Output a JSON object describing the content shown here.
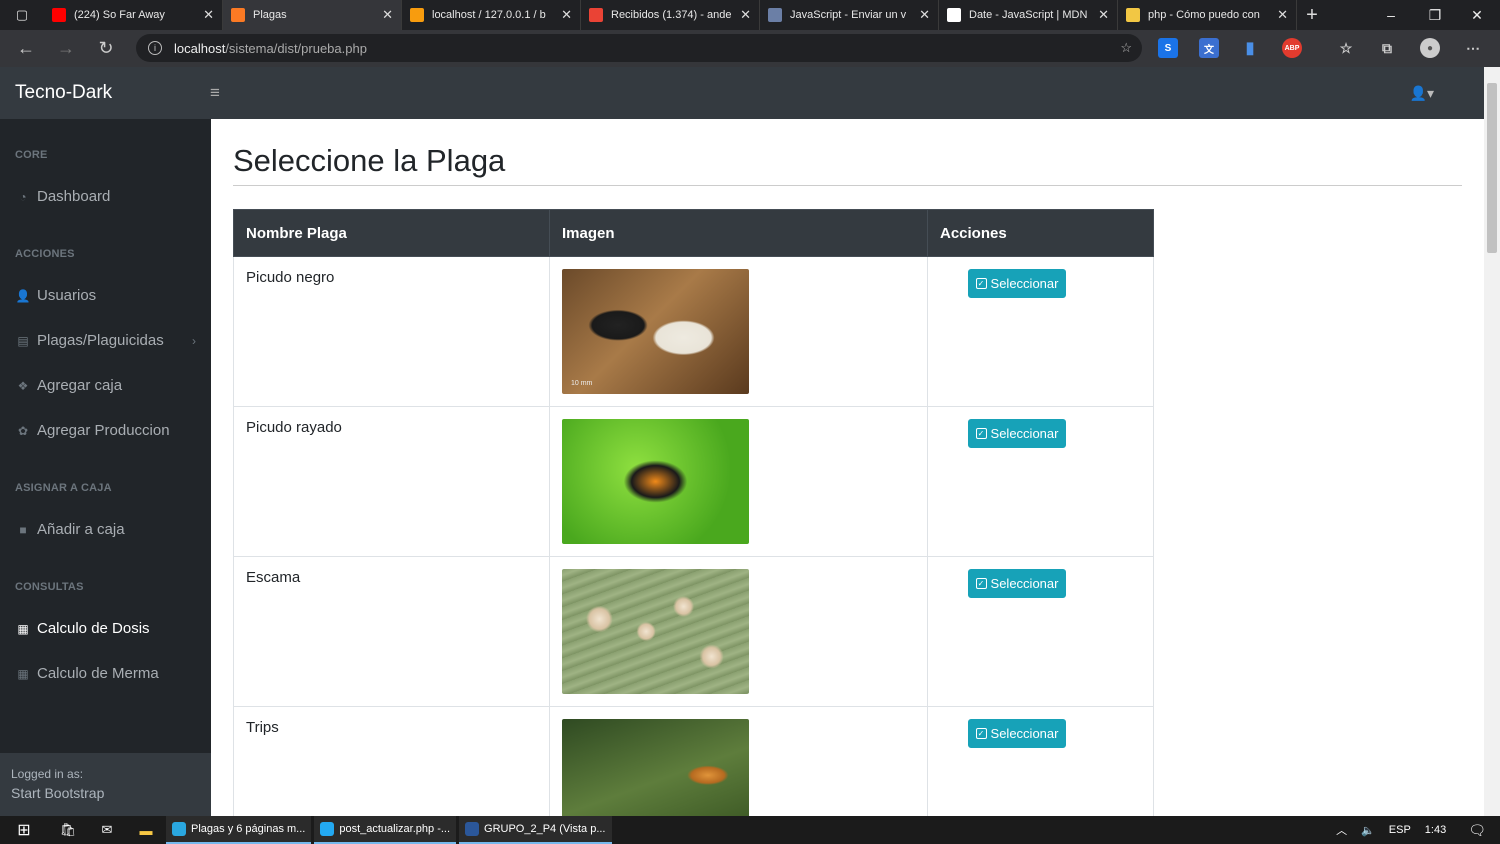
{
  "browser": {
    "tabs": [
      {
        "title": "(224) So Far Away",
        "icon": "youtube-icon",
        "color": "#ff0000",
        "active": false
      },
      {
        "title": "Plagas",
        "icon": "xampp-icon",
        "color": "#fb7a24",
        "active": true
      },
      {
        "title": "localhost / 127.0.0.1 / b",
        "icon": "phpmyadmin-icon",
        "color": "#f89c0e",
        "active": false
      },
      {
        "title": "Recibidos (1.374) - ande",
        "icon": "gmail-icon",
        "color": "#ea4335",
        "active": false
      },
      {
        "title": "JavaScript - Enviar un v",
        "icon": "page-icon",
        "color": "#6b7fa6",
        "active": false
      },
      {
        "title": "Date - JavaScript | MDN",
        "icon": "mdn-icon",
        "color": "#ffffff",
        "active": false
      },
      {
        "title": "php - Cómo puedo con",
        "icon": "stackoverflow-icon",
        "color": "#f2c744",
        "active": false
      }
    ],
    "url_host": "localhost",
    "url_path": "/sistema/dist/prueba.php"
  },
  "navbar": {
    "brand": "Tecno-Dark"
  },
  "sidebar": {
    "headings": [
      "CORE",
      "ACCIONES",
      "ASIGNAR A CAJA",
      "CONSULTAS"
    ],
    "items": [
      {
        "label": "Dashboard",
        "icon": "dashboard-icon"
      },
      {
        "label": "Usuarios",
        "icon": "user-add-icon"
      },
      {
        "label": "Plagas/Plaguicidas",
        "icon": "list-icon"
      },
      {
        "label": "Agregar caja",
        "icon": "boxes-icon"
      },
      {
        "label": "Agregar Produccion",
        "icon": "seedling-icon"
      },
      {
        "label": "Añadir a caja",
        "icon": "box-icon"
      },
      {
        "label": "Calculo de Dosis",
        "icon": "calculator-icon"
      },
      {
        "label": "Calculo de Merma",
        "icon": "calculator-icon"
      }
    ],
    "footer_label": "Logged in as:",
    "footer_user": "Start Bootstrap"
  },
  "page": {
    "title": "Seleccione la Plaga",
    "table": {
      "headers": [
        "Nombre Plaga",
        "Imagen",
        "Acciones"
      ],
      "rows": [
        {
          "name": "Picudo negro",
          "image_caption": "10 mm",
          "action": "Seleccionar"
        },
        {
          "name": "Picudo rayado",
          "image_caption": "",
          "action": "Seleccionar"
        },
        {
          "name": "Escama",
          "image_caption": "",
          "action": "Seleccionar"
        },
        {
          "name": "Trips",
          "image_caption": "",
          "action": "Seleccionar"
        }
      ]
    }
  },
  "taskbar": {
    "apps": [
      {
        "label": "Plagas y 6 páginas m...",
        "icon": "edge-icon",
        "color": "#2aa7e0"
      },
      {
        "label": "post_actualizar.php -...",
        "icon": "vscode-icon",
        "color": "#23a9f2"
      },
      {
        "label": "GRUPO_2_P4 (Vista p...",
        "icon": "word-icon",
        "color": "#2b579a"
      }
    ],
    "lang": "ESP",
    "time": "1:43"
  }
}
